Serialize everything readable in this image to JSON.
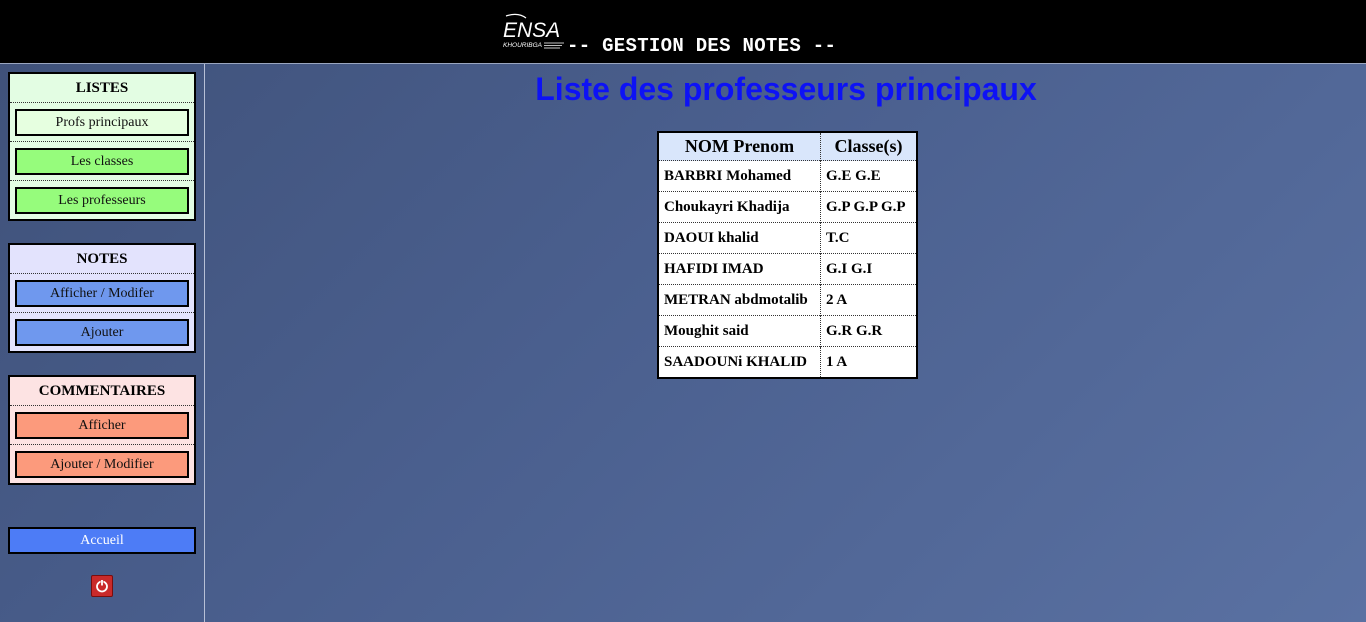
{
  "header": {
    "logo_text": "ENSA",
    "logo_subtext": "KHOURIBGA",
    "title": "-- GESTION DES NOTES --"
  },
  "sidebar": {
    "listes": {
      "title": "LISTES",
      "items": [
        "Profs principaux",
        "Les classes",
        "Les professeurs"
      ]
    },
    "notes": {
      "title": "NOTES",
      "items": [
        "Afficher / Modifer",
        "Ajouter"
      ]
    },
    "commentaires": {
      "title": "COMMENTAIRES",
      "items": [
        "Afficher",
        "Ajouter / Modifier"
      ]
    },
    "home_label": "Accueil",
    "power_icon": "power-icon"
  },
  "main": {
    "title": "Liste des professeurs principaux",
    "table": {
      "headers": [
        "NOM Prenom",
        "Classe(s)"
      ],
      "rows": [
        [
          "BARBRI Mohamed",
          "G.E G.E"
        ],
        [
          "Choukayri Khadija",
          "G.P G.P G.P"
        ],
        [
          "DAOUI khalid",
          "T.C"
        ],
        [
          "HAFIDI IMAD",
          "G.I G.I"
        ],
        [
          "METRAN abdmotalib",
          "2 A"
        ],
        [
          "Moughit said",
          "G.R G.R"
        ],
        [
          "SAADOUNi KHALID",
          "1 A"
        ]
      ]
    }
  },
  "colors": {
    "header_bg": "#000000",
    "title_blue": "#0d12f5",
    "listes_btn": "#96fc7c",
    "notes_btn": "#6f98ee",
    "comm_btn": "#fc9a7c",
    "home_btn": "#4d7cf6"
  }
}
